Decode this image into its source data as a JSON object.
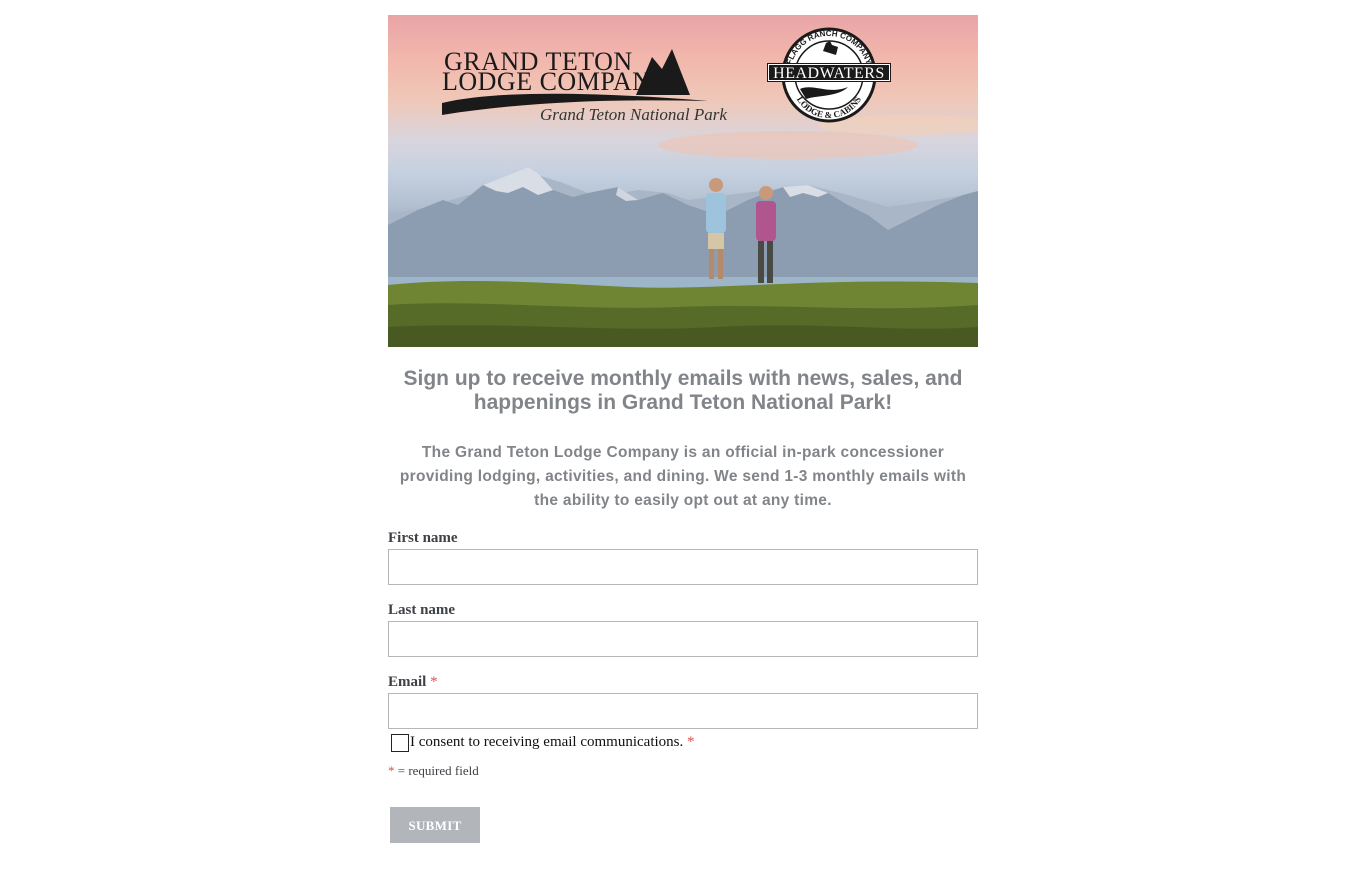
{
  "header": {
    "brand_line1": "Grand Teton",
    "brand_line2": "Lodge Company",
    "brand_park": "Grand Teton National Park",
    "partner_top_arc": "Flagg Ranch Company",
    "partner_name": "Headwaters",
    "partner_bottom_arc": "Lodge & Cabins"
  },
  "headline": "Sign up to receive monthly emails with news, sales, and happenings in Grand Teton National Park!",
  "intro": "The Grand Teton Lodge Company is an official in-park concessioner providing lodging, activities, and dining. We send 1-3 monthly emails with the ability to easily opt out at any time.",
  "form": {
    "first_name_label": "First name",
    "first_name_value": "",
    "last_name_label": "Last name",
    "last_name_value": "",
    "email_label": "Email",
    "email_value": "",
    "required_marker": "*",
    "consent_label": "I consent to receiving email communications.",
    "consent_checked": false,
    "required_note": "= required field",
    "submit_label": "SUBMIT"
  },
  "colors": {
    "heading_gray": "#818489",
    "required_red": "#d9534f",
    "button_gray": "#b2b5b9"
  }
}
